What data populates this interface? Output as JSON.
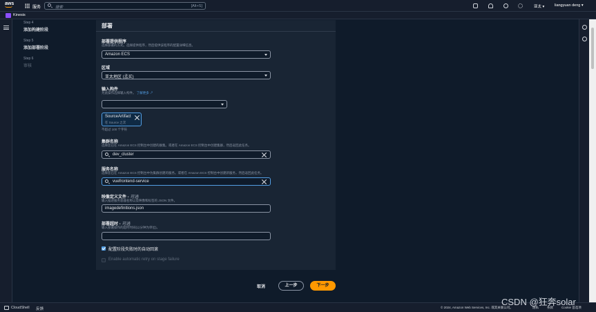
{
  "topbar": {
    "logo": "aws",
    "services_label": "服务",
    "search_placeholder": "搜索",
    "search_shortcut": "[Alt+S]",
    "region": "亚太 ▾",
    "user": "liangyuan deng ▾",
    "icons": [
      "cloudshell-icon",
      "bell-icon",
      "help-icon",
      "gear-icon"
    ]
  },
  "subbar": {
    "service": "Kinesis"
  },
  "steps": [
    {
      "label": "Step 4",
      "title": "添加构建阶段",
      "state": "done"
    },
    {
      "label": "Step 5",
      "title": "添加部署阶段",
      "state": "current"
    },
    {
      "label": "Step 6",
      "title": "审核",
      "state": "pending"
    }
  ],
  "panel": {
    "title": "部署"
  },
  "form": {
    "provider": {
      "label": "部署提供程序",
      "desc": "选择部署的方式。选择提供程序，然后提供该程序的配置详细信息。",
      "value": "Amazon ECS"
    },
    "region": {
      "label": "区域",
      "value": "亚太地区 (孟买)"
    },
    "artifact": {
      "label": "输入构件",
      "desc": "为此操作选择输入构件。",
      "link": "了解更多",
      "value": "",
      "token_name": "SourceArtifact",
      "token_sub": "在 Source 之次",
      "limit": "不超过 100 个字符"
    },
    "cluster": {
      "label": "集群名称",
      "desc": "选择您已在 Amazon ECS 控制台中创建的群集。或者在 Amazon ECS 控制台中创建集群，然后返回此任务。",
      "value": "dev_cluster"
    },
    "service": {
      "label": "服务名称",
      "desc": "选择您已在 Amazon ECS 控制台中为集群创建的服务。或者在 Amazon ECS 控制台中创建新服务，然后返回此任务。",
      "value": "vuefrontend-service"
    },
    "image_file": {
      "label": "映像定义文件",
      "optional": "可选",
      "desc": "输入描述服务容器名称以及映像和标签的 JSON 文件。",
      "value": "imagedefinitions.json"
    },
    "timeout": {
      "label": "部署超时",
      "optional": "可选",
      "desc": "输入部署操作的超时时间(以分钟为单位)。",
      "value": ""
    },
    "rollback": {
      "label": "配置阶段失败时的自动回滚",
      "checked": true
    },
    "retry": {
      "label": "Enable automatic retry on stage failure",
      "checked": false,
      "disabled": true
    }
  },
  "actions": {
    "cancel": "取消",
    "previous": "上一步",
    "next": "下一步"
  },
  "footer": {
    "cloudshell": "CloudShell",
    "feedback": "反馈",
    "copyright": "© 2024, Amazon Web Services, Inc. 或其关联公司。",
    "links": [
      "隐私",
      "条款",
      "Cookie 首选项"
    ]
  },
  "watermark": "CSDN @狂奔solar"
}
